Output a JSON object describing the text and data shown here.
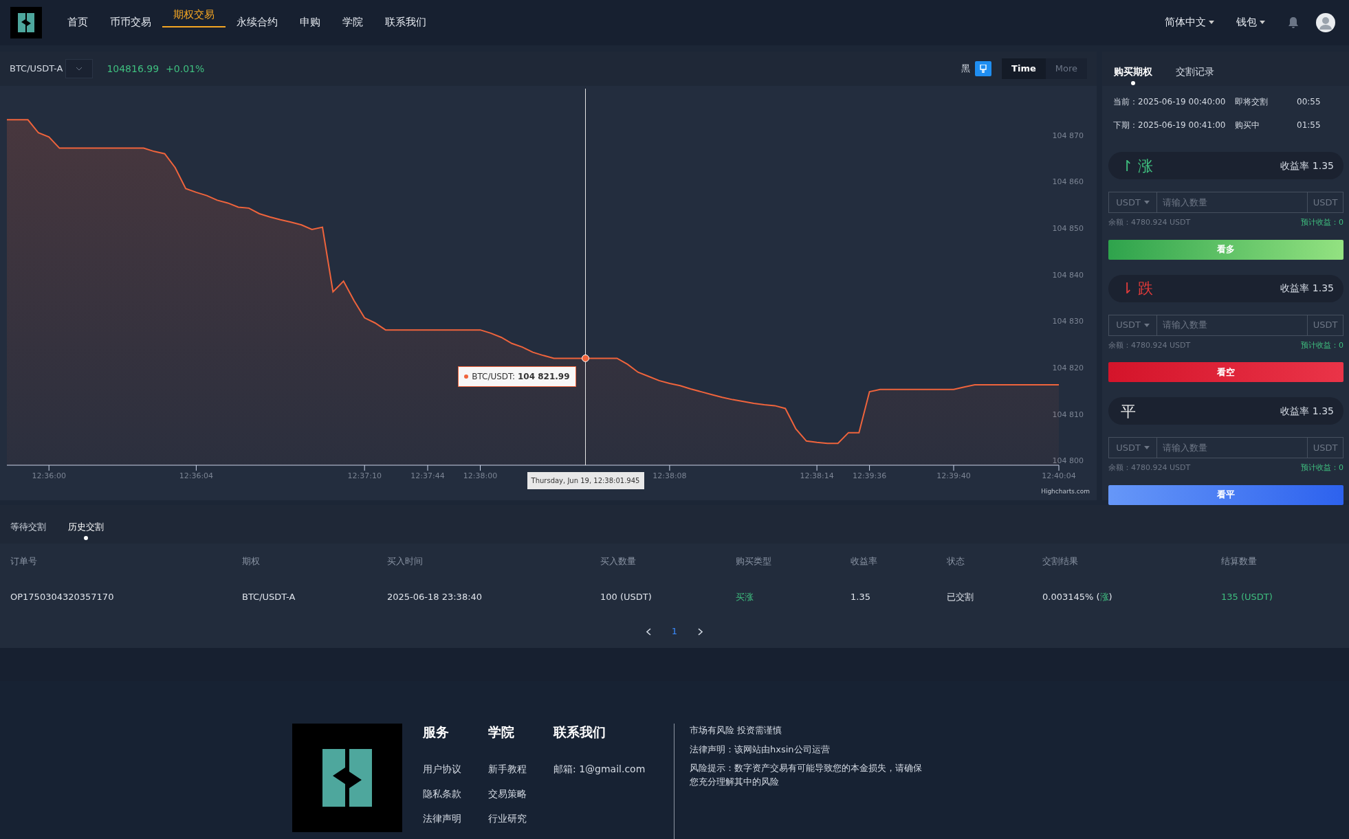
{
  "nav": {
    "items": [
      {
        "label": "首页",
        "selected": false
      },
      {
        "label": "币币交易",
        "selected": false
      },
      {
        "label": "期权交易",
        "selected": true
      },
      {
        "label": "永续合约",
        "selected": false
      },
      {
        "label": "申购",
        "selected": false
      },
      {
        "label": "学院",
        "selected": false
      },
      {
        "label": "联系我们",
        "selected": false
      }
    ],
    "language": "简体中文",
    "wallet": "钱包"
  },
  "chart_panel": {
    "symbol": "BTC/USDT-A",
    "price": "104816.99",
    "change": "+0.01%",
    "theme_label": "黑",
    "range_buttons": [
      {
        "label": "Time",
        "selected": true
      },
      {
        "label": "More",
        "selected": false
      }
    ],
    "chart_data": {
      "type": "area",
      "ylim": [
        104799,
        104880
      ],
      "categories": [
        null,
        null,
        null,
        null,
        "12:36:00",
        null,
        null,
        null,
        null,
        null,
        null,
        null,
        null,
        null,
        null,
        null,
        null,
        null,
        "12:36:04",
        null,
        null,
        null,
        null,
        null,
        null,
        null,
        null,
        null,
        null,
        null,
        null,
        null,
        null,
        null,
        "12:37:10",
        null,
        null,
        null,
        null,
        null,
        "12:37:44",
        null,
        null,
        null,
        null,
        "12:38:00",
        null,
        null,
        null,
        null,
        null,
        null,
        null,
        null,
        null,
        null,
        null,
        null,
        null,
        null,
        null,
        null,
        null,
        "12:38:08",
        null,
        null,
        null,
        null,
        null,
        null,
        null,
        null,
        null,
        null,
        null,
        null,
        null,
        "12:38:14",
        null,
        null,
        null,
        null,
        "12:39:36",
        null,
        null,
        null,
        null,
        null,
        null,
        null,
        "12:39:40",
        null,
        null,
        null,
        null,
        null,
        null,
        null,
        null,
        null,
        "12:40:04"
      ],
      "yticks": [
        {
          "value": 104800,
          "label": "104 800"
        },
        {
          "value": 104810,
          "label": "104 810"
        },
        {
          "value": 104820,
          "label": "104 820"
        },
        {
          "value": 104830,
          "label": "104 830"
        },
        {
          "value": 104840,
          "label": "104 840"
        },
        {
          "value": 104850,
          "label": "104 850"
        },
        {
          "value": 104860,
          "label": "104 860"
        },
        {
          "value": 104870,
          "label": "104 870"
        }
      ],
      "series": [
        {
          "color": "#f0643c",
          "values": [
            104873.3,
            104873.3,
            104873.3,
            104870.5,
            104869.6,
            104867.2,
            104867.2,
            104867.2,
            104867.2,
            104867.2,
            104867.2,
            104867.2,
            104867.2,
            104867.2,
            104866.5,
            104866,
            104863,
            104858.5,
            104857.7,
            104857,
            104856,
            104855.4,
            104854.5,
            104854.3,
            104853.1,
            104852.4,
            104851.8,
            104851.3,
            104850.7,
            104849.7,
            104850.2,
            104836.3,
            104838.6,
            104834.4,
            104830.7,
            104829.6,
            104828.1,
            104828.1,
            104828.1,
            104828.1,
            104828.1,
            104828.1,
            104828.1,
            104828.1,
            104828.1,
            104828.1,
            104827.4,
            104826.5,
            104825.2,
            104824.4,
            104823.3,
            104822.6,
            104822,
            104822,
            104822,
            104822,
            104822,
            104822,
            104822,
            104820.7,
            104819,
            104818.1,
            104817.2,
            104816.6,
            104816.1,
            104815.4,
            104814.8,
            104814.2,
            104813.6,
            104813.1,
            104812.7,
            104812.3,
            104812,
            104811.8,
            104811.2,
            104806.8,
            104804.2,
            104803.9,
            104803.7,
            104803.7,
            104806,
            104806,
            104814.8,
            104815.3,
            104815.3,
            104815.3,
            104815.3,
            104815.3,
            104815.3,
            104815.3,
            104815.3,
            104815.8,
            104816.3,
            104816.3,
            104816.3,
            104816.3,
            104816.3,
            104816.3,
            104816.3,
            104816.3,
            104816.3
          ]
        }
      ],
      "annotations": [
        {
          "text": "BTC/USDT: **104 821.99**"
        }
      ]
    },
    "crosshair_label": "Thursday, Jun 19, 12:38:01.945",
    "credit": "Highcharts.com"
  },
  "order_panel": {
    "tabs": [
      {
        "label": "购买期权",
        "selected": true
      },
      {
        "label": "交割记录",
        "selected": false
      }
    ],
    "periods": [
      {
        "label": "当前：2025-06-19 00:40:00",
        "status": "即将交割",
        "countdown": "00:55"
      },
      {
        "label": "下期：2025-06-19 00:41:00",
        "status": "购买中",
        "countdown": "01:55"
      }
    ],
    "options": [
      {
        "kind": "up",
        "arrow": "↾",
        "label": "涨",
        "rate": "收益率 1.35",
        "currency": "USDT",
        "placeholder": "请输入数量",
        "unit": "USDT",
        "balance": "余额：4780.924 USDT",
        "expected": "预计收益：0",
        "button": "看多"
      },
      {
        "kind": "down",
        "arrow": "⇂",
        "label": "跌",
        "rate": "收益率 1.35",
        "currency": "USDT",
        "placeholder": "请输入数量",
        "unit": "USDT",
        "balance": "余额：4780.924 USDT",
        "expected": "预计收益：0",
        "button": "看空"
      },
      {
        "kind": "flat",
        "label": "平",
        "rate": "收益率 1.35",
        "currency": "USDT",
        "placeholder": "请输入数量",
        "unit": "USDT",
        "balance": "余额：4780.924 USDT",
        "expected": "预计收益：0",
        "button": "看平"
      }
    ]
  },
  "orders": {
    "tabs": [
      {
        "label": "等待交割",
        "selected": false
      },
      {
        "label": "历史交割",
        "selected": true
      }
    ],
    "columns": [
      "订单号",
      "期权",
      "买入时间",
      "买入数量",
      "购买类型",
      "收益率",
      "状态",
      "交割结果",
      "结算数量"
    ],
    "rows": [
      {
        "cells": [
          {
            "text": "OP1750304320357170"
          },
          {
            "text": "BTC/USDT-A"
          },
          {
            "text": "2025-06-18 23:38:40"
          },
          {
            "text": "100 (USDT)"
          },
          {
            "text": "买涨",
            "color": "#3fbf7f"
          },
          {
            "text": "1.35"
          },
          {
            "text": "已交割"
          },
          {
            "text": "0.003145% (",
            "direction": "涨",
            "close": ")"
          },
          {
            "text": "135 (USDT)",
            "color": "#3fbf7f"
          }
        ]
      }
    ],
    "pages": [
      {
        "label": "1",
        "selected": true
      }
    ]
  },
  "footer": {
    "columns": [
      {
        "title": "服务",
        "links": [
          "用户协议",
          "隐私条款",
          "法律声明"
        ]
      },
      {
        "title": "学院",
        "links": [
          "新手教程",
          "交易策略",
          "行业研究"
        ]
      },
      {
        "title": "联系我们",
        "links": [
          "邮箱: 1@gmail.com"
        ]
      }
    ],
    "notices": [
      "市场有风险 投资需谨慎",
      "法律声明：该网站由hxsin公司运营",
      "风险提示：数字资产交易有可能导致您的本金损失，请确保您充分理解其中的风险"
    ]
  }
}
